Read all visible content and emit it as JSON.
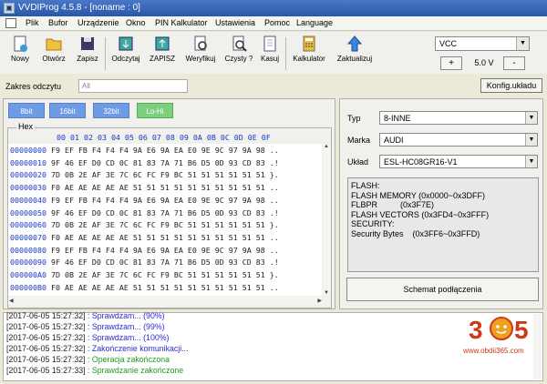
{
  "window": {
    "title": "VVDIProg 4.5.8 - [noname : 0]"
  },
  "menu": [
    "Plik",
    "Bufor",
    "Urządzenie",
    "Okno",
    "PIN Kalkulator",
    "Ustawienia",
    "Pomoc",
    "Language"
  ],
  "toolbar": {
    "new": "Nowy",
    "open": "Otwórz",
    "save": "Zapisz",
    "read": "Odczytaj",
    "write": "ZAPISZ",
    "verify": "Weryfikuj",
    "blank": "Czysty ?",
    "erase": "Kasuj",
    "calculator": "Kalkulator",
    "update": "Zaktualizuj"
  },
  "power": {
    "select": "VCC",
    "plus": "+",
    "value": "5.0 V",
    "minus": "-"
  },
  "read_range": {
    "label": "Zakres odczytu",
    "value": "All"
  },
  "config_button": "Konfig.układu",
  "view_tabs": [
    "8bit",
    "16bit",
    "32bit",
    "Lo-Hi"
  ],
  "hex": {
    "label": "Hex",
    "header": "00 01 02 03 04 05 06 07 08 09 0A 0B 0C 0D 0E 0F",
    "rows": [
      {
        "addr": "00000000",
        "bytes": "F9 EF FB F4 F4 F4 9A E6 9A EA E0 9E 9C 97 9A 98 .."
      },
      {
        "addr": "00000010",
        "bytes": "9F 46 EF D0 CD 0C 81 83 7A 71 B6 D5 0D 93 CD 83 .!"
      },
      {
        "addr": "00000020",
        "bytes": "7D 0B 2E AF 3E 7C 6C FC F9 BC 51 51 51 51 51 51 }."
      },
      {
        "addr": "00000030",
        "bytes": "F0 AE AE AE AE AE 51 51 51 51 51 51 51 51 51 51 .."
      },
      {
        "addr": "00000040",
        "bytes": "F9 EF FB F4 F4 F4 9A E6 9A EA E0 9E 9C 97 9A 98 .."
      },
      {
        "addr": "00000050",
        "bytes": "9F 46 EF D0 CD 0C 81 83 7A 71 B6 D5 0D 93 CD 83 .!"
      },
      {
        "addr": "00000060",
        "bytes": "7D 0B 2E AF 3E 7C 6C FC F9 BC 51 51 51 51 51 51 }."
      },
      {
        "addr": "00000070",
        "bytes": "F0 AE AE AE AE AE 51 51 51 51 51 51 51 51 51 51 .."
      },
      {
        "addr": "00000080",
        "bytes": "F9 EF FB F4 F4 F4 9A E6 9A EA E0 9E 9C 97 9A 98 .."
      },
      {
        "addr": "00000090",
        "bytes": "9F 46 EF D0 CD 0C 81 83 7A 71 B6 D5 0D 93 CD 83 .!"
      },
      {
        "addr": "000000A0",
        "bytes": "7D 0B 2E AF 3E 7C 6C FC F9 BC 51 51 51 51 51 51 }."
      },
      {
        "addr": "000000B0",
        "bytes": "F0 AE AE AE AE AE 51 51 51 51 51 51 51 51 51 51 .."
      }
    ]
  },
  "device": {
    "type_label": "Typ",
    "type_value": "8-INNE",
    "brand_label": "Marka",
    "brand_value": "AUDI",
    "chip_label": "Układ",
    "chip_value": "ESL-HC08GR16-V1",
    "info": [
      "FLASH:",
      "FLASH MEMORY (0x0000~0x3DFF)",
      "FLBPR          (0x3F7E)",
      "FLASH VECTORS (0x3FD4~0x3FFF)",
      "SECURITY:",
      "Security Bytes    (0x3FF6~0x3FFD)"
    ],
    "schematic_button": "Schemat podłączenia"
  },
  "log": [
    {
      "time": "[2017-06-05 15:27:32]",
      "msg": " : Sprawdzam... (90%)",
      "color": "#2a2ad0"
    },
    {
      "time": "[2017-06-05 15:27:32]",
      "msg": " : Sprawdzam... (99%)",
      "color": "#2a2ad0"
    },
    {
      "time": "[2017-06-05 15:27:32]",
      "msg": " : Sprawdzam... (100%)",
      "color": "#2a2ad0"
    },
    {
      "time": "[2017-06-05 15:27:32]",
      "msg": " : Zakończenie komunikacji...",
      "color": "#2a2ad0"
    },
    {
      "time": "[2017-06-05 15:27:32]",
      "msg": " : Operacja zakończona",
      "color": "#1e9a1e"
    },
    {
      "time": "[2017-06-05 15:27:33]",
      "msg": " : Sprawdzanie zakończone",
      "color": "#1e9a1e"
    }
  ],
  "watermark": {
    "logo": "385",
    "url": "www.obdii365.com"
  },
  "colors": {
    "tab_blue": "#6e9be6",
    "tab_green": "#7ccf7c",
    "hex_blue": "#1a38c8",
    "watermark": "#cc3a1a"
  }
}
